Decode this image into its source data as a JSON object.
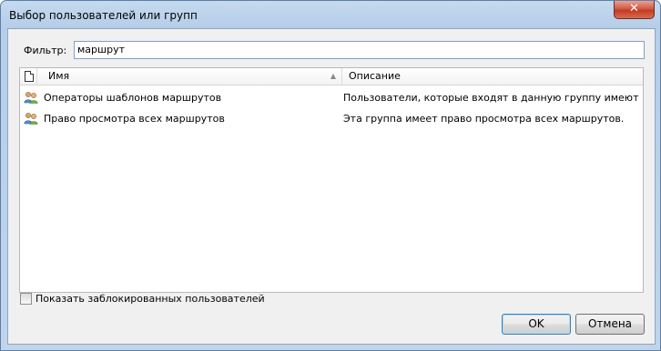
{
  "window": {
    "title": "Выбор пользователей или групп",
    "close_label": "✕"
  },
  "filter": {
    "label": "Фильтр:",
    "value": "маршрут"
  },
  "list": {
    "columns": {
      "name": "Имя",
      "description": "Описание"
    },
    "rows": [
      {
        "name": "Операторы шаблонов маршрутов",
        "description": "Пользователи, которые входят в данную группу имеют возмо..."
      },
      {
        "name": "Право просмотра всех маршрутов",
        "description": "Эта группа имеет право просмотра всех маршрутов."
      }
    ]
  },
  "show_blocked": {
    "label": "Показать заблокированных пользователей",
    "checked": false
  },
  "buttons": {
    "ok": "OK",
    "cancel": "Отмена"
  }
}
